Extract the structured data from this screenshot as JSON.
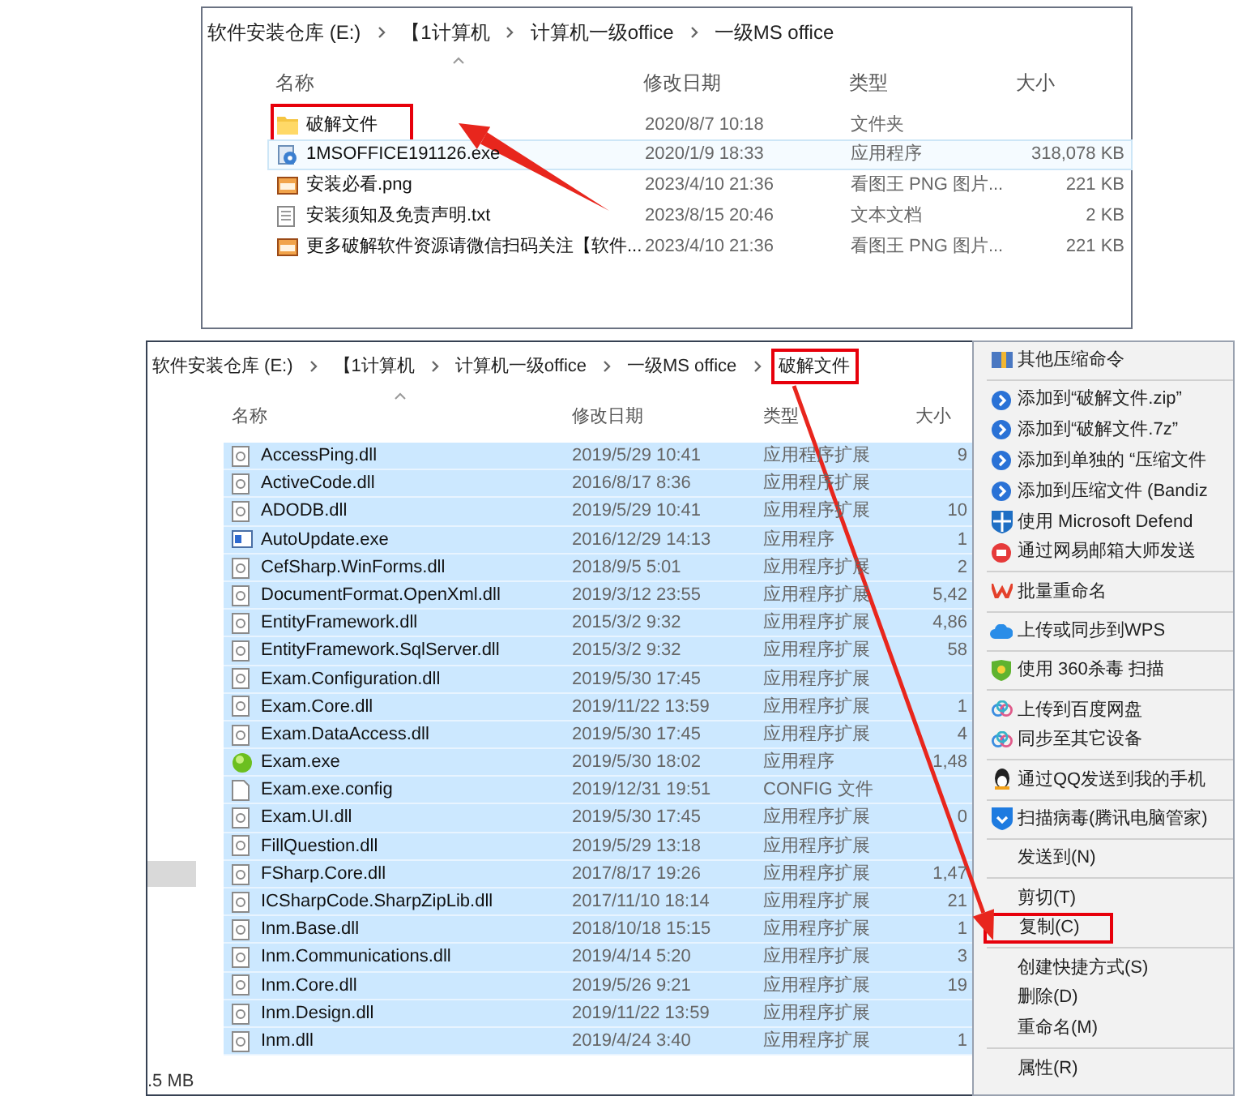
{
  "top_window": {
    "breadcrumb": [
      {
        "text": "软件安装仓库 (E:)",
        "highlighted": false
      },
      {
        "text": "【1计算机",
        "highlighted": false
      },
      {
        "text": "计算机一级office",
        "highlighted": false
      },
      {
        "text": "一级MS office",
        "highlighted": false
      }
    ],
    "columns": [
      {
        "label": "名称",
        "sorted": true
      },
      {
        "label": "修改日期",
        "sorted": false
      },
      {
        "label": "类型",
        "sorted": false
      },
      {
        "label": "大小",
        "sorted": false
      }
    ],
    "rows": [
      {
        "kind": "folder",
        "name": "破解文件",
        "date": "2020/8/7 10:18",
        "type": "文件夹",
        "selected": false,
        "hovered": false,
        "highlighted": true
      },
      {
        "kind": "installer",
        "name": "1MSOFFICE191126.exe",
        "date": "2020/1/9 18:33",
        "type": "应用程序",
        "size": "318,078 KB",
        "selected": false,
        "hovered": true,
        "highlighted": false
      },
      {
        "kind": "image",
        "name": "安装必看.png",
        "date": "2023/4/10 21:36",
        "type": "看图王 PNG 图片...",
        "size": "221 KB",
        "selected": false,
        "hovered": false,
        "highlighted": false
      },
      {
        "kind": "text",
        "name": "安装须知及免责声明.txt",
        "date": "2023/8/15 20:46",
        "type": "文本文档",
        "size": "2 KB",
        "selected": false,
        "hovered": false,
        "highlighted": false
      },
      {
        "kind": "image",
        "name": "更多破解软件资源请微信扫码关注【软件...",
        "date": "2023/4/10 21:36",
        "type": "看图王 PNG 图片...",
        "size": "221 KB",
        "selected": false,
        "hovered": false,
        "highlighted": false
      }
    ]
  },
  "bottom_window": {
    "breadcrumb": [
      {
        "text": "软件安装仓库 (E:)",
        "highlighted": false
      },
      {
        "text": "【1计算机",
        "highlighted": false
      },
      {
        "text": "计算机一级office",
        "highlighted": false
      },
      {
        "text": "一级MS office",
        "highlighted": false
      },
      {
        "text": "破解文件",
        "highlighted": true
      }
    ],
    "columns": [
      {
        "label": "名称",
        "sorted": true
      },
      {
        "label": "修改日期",
        "sorted": false
      },
      {
        "label": "类型",
        "sorted": false
      },
      {
        "label": "大小",
        "sorted": false
      }
    ],
    "rows": [
      {
        "kind": "dll",
        "name": "AccessPing.dll",
        "date": "2019/5/29 10:41",
        "type": "应用程序扩展",
        "size": "9",
        "selected": true
      },
      {
        "kind": "dll",
        "name": "ActiveCode.dll",
        "date": "2016/8/17 8:36",
        "type": "应用程序扩展",
        "selected": true
      },
      {
        "kind": "dll",
        "name": "ADODB.dll",
        "date": "2019/5/29 10:41",
        "type": "应用程序扩展",
        "size": "10",
        "selected": true
      },
      {
        "kind": "app",
        "name": "AutoUpdate.exe",
        "date": "2016/12/29 14:13",
        "type": "应用程序",
        "size": "1",
        "selected": true
      },
      {
        "kind": "dll",
        "name": "CefSharp.WinForms.dll",
        "date": "2018/9/5 5:01",
        "type": "应用程序扩展",
        "size": "2",
        "selected": true
      },
      {
        "kind": "dll",
        "name": "DocumentFormat.OpenXml.dll",
        "date": "2019/3/12 23:55",
        "type": "应用程序扩展",
        "size": "5,42",
        "selected": true
      },
      {
        "kind": "dll",
        "name": "EntityFramework.dll",
        "date": "2015/3/2 9:32",
        "type": "应用程序扩展",
        "size": "4,86",
        "selected": true
      },
      {
        "kind": "dll",
        "name": "EntityFramework.SqlServer.dll",
        "date": "2015/3/2 9:32",
        "type": "应用程序扩展",
        "size": "58",
        "selected": true
      },
      {
        "kind": "dll",
        "name": "Exam.Configuration.dll",
        "date": "2019/5/30 17:45",
        "type": "应用程序扩展",
        "selected": true
      },
      {
        "kind": "dll",
        "name": "Exam.Core.dll",
        "date": "2019/11/22 13:59",
        "type": "应用程序扩展",
        "size": "1",
        "selected": true
      },
      {
        "kind": "dll",
        "name": "Exam.DataAccess.dll",
        "date": "2019/5/30 17:45",
        "type": "应用程序扩展",
        "size": "4",
        "selected": true
      },
      {
        "kind": "exam",
        "name": "Exam.exe",
        "date": "2019/5/30 18:02",
        "type": "应用程序",
        "size": "1,48",
        "selected": true
      },
      {
        "kind": "config",
        "name": "Exam.exe.config",
        "date": "2019/12/31 19:51",
        "type": "CONFIG 文件",
        "selected": true
      },
      {
        "kind": "dll",
        "name": "Exam.UI.dll",
        "date": "2019/5/30 17:45",
        "type": "应用程序扩展",
        "size": "0",
        "selected": true
      },
      {
        "kind": "dll",
        "name": "FillQuestion.dll",
        "date": "2019/5/29 13:18",
        "type": "应用程序扩展",
        "selected": true
      },
      {
        "kind": "dll",
        "name": "FSharp.Core.dll",
        "date": "2017/8/17 19:26",
        "type": "应用程序扩展",
        "size": "1,47",
        "selected": true
      },
      {
        "kind": "dll",
        "name": "ICSharpCode.SharpZipLib.dll",
        "date": "2017/11/10 18:14",
        "type": "应用程序扩展",
        "size": "21",
        "selected": true
      },
      {
        "kind": "dll",
        "name": "Inm.Base.dll",
        "date": "2018/10/18 15:15",
        "type": "应用程序扩展",
        "size": "1",
        "selected": true
      },
      {
        "kind": "dll",
        "name": "Inm.Communications.dll",
        "date": "2019/4/14 5:20",
        "type": "应用程序扩展",
        "size": "3",
        "selected": true
      },
      {
        "kind": "dll",
        "name": "Inm.Core.dll",
        "date": "2019/5/26 9:21",
        "type": "应用程序扩展",
        "size": "19",
        "selected": true
      },
      {
        "kind": "dll",
        "name": "Inm.Design.dll",
        "date": "2019/11/22 13:59",
        "type": "应用程序扩展",
        "selected": true
      },
      {
        "kind": "dll",
        "name": "Inm.dll",
        "date": "2019/4/24 3:40",
        "type": "应用程序扩展",
        "size": "1",
        "selected": true
      }
    ],
    "status_bar": ".5 MB"
  },
  "context_menu": {
    "items": [
      {
        "kind": "item",
        "label": "其他压缩命令",
        "highlighted": false
      },
      {
        "kind": "separator"
      },
      {
        "kind": "item",
        "label": "添加到“破解文件.zip”",
        "highlighted": false
      },
      {
        "kind": "item",
        "label": "添加到“破解文件.7z”",
        "highlighted": false
      },
      {
        "kind": "item",
        "label": "添加到单独的 “压缩文件",
        "highlighted": false
      },
      {
        "kind": "item",
        "label": "添加到压缩文件 (Bandiz",
        "highlighted": false
      },
      {
        "kind": "item",
        "label": "使用 Microsoft Defend",
        "highlighted": false
      },
      {
        "kind": "item",
        "label": "通过网易邮箱大师发送",
        "highlighted": false
      },
      {
        "kind": "separator"
      },
      {
        "kind": "item",
        "label": "批量重命名",
        "highlighted": false
      },
      {
        "kind": "separator"
      },
      {
        "kind": "item",
        "label": "上传或同步到WPS",
        "highlighted": false
      },
      {
        "kind": "separator"
      },
      {
        "kind": "item",
        "label": "使用 360杀毒 扫描",
        "highlighted": false
      },
      {
        "kind": "separator"
      },
      {
        "kind": "item",
        "label": "上传到百度网盘",
        "highlighted": false
      },
      {
        "kind": "item",
        "label": "同步至其它设备",
        "highlighted": false
      },
      {
        "kind": "separator"
      },
      {
        "kind": "item",
        "label": "通过QQ发送到我的手机",
        "highlighted": false
      },
      {
        "kind": "separator"
      },
      {
        "kind": "item",
        "label": "扫描病毒(腾讯电脑管家)",
        "highlighted": false
      },
      {
        "kind": "separator"
      },
      {
        "kind": "item",
        "label": "发送到(N)",
        "highlighted": false
      },
      {
        "kind": "separator"
      },
      {
        "kind": "item",
        "label": "剪切(T)",
        "highlighted": false
      },
      {
        "kind": "item",
        "label": "复制(C)",
        "highlighted": true
      },
      {
        "kind": "separator"
      },
      {
        "kind": "item",
        "label": "创建快捷方式(S)",
        "highlighted": false
      },
      {
        "kind": "item",
        "label": "删除(D)",
        "highlighted": false
      },
      {
        "kind": "item",
        "label": "重命名(M)",
        "highlighted": false
      },
      {
        "kind": "separator"
      },
      {
        "kind": "item",
        "label": "属性(R)",
        "highlighted": false
      }
    ]
  }
}
